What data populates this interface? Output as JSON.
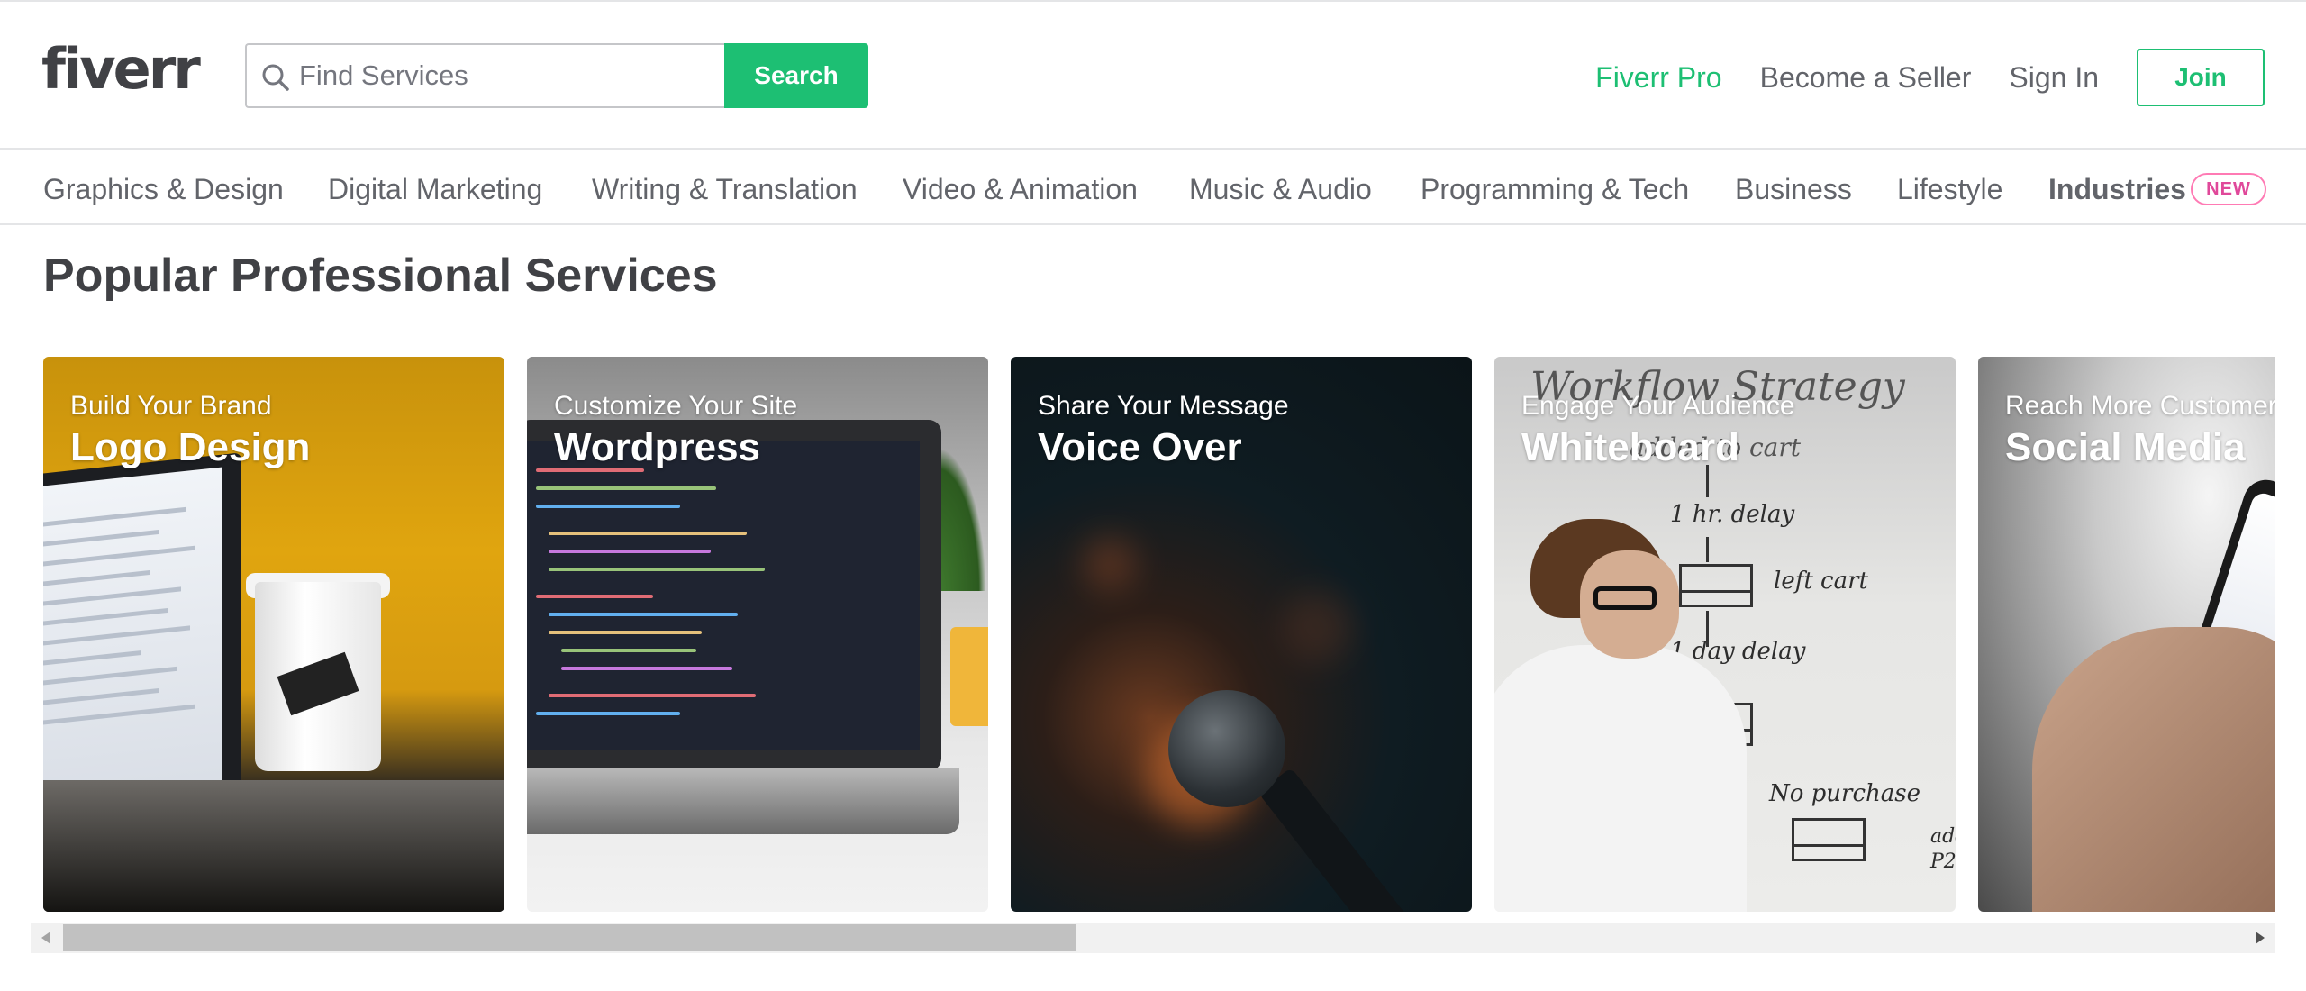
{
  "header": {
    "logo": "fiverr",
    "search": {
      "placeholder": "Find Services",
      "value": "",
      "button_label": "Search",
      "icon": "search-icon"
    },
    "nav": {
      "pro": "Fiverr Pro",
      "seller": "Become a Seller",
      "sign_in": "Sign In",
      "join": "Join"
    }
  },
  "categories": {
    "items": [
      "Graphics & Design",
      "Digital Marketing",
      "Writing & Translation",
      "Video & Animation",
      "Music & Audio",
      "Programming & Tech",
      "Business",
      "Lifestyle",
      "Industries"
    ],
    "badge": "NEW"
  },
  "section": {
    "title": "Popular Professional Services",
    "cards": [
      {
        "subtitle": "Build Your Brand",
        "title": "Logo Design"
      },
      {
        "subtitle": "Customize Your Site",
        "title": "Wordpress"
      },
      {
        "subtitle": "Share Your Message",
        "title": "Voice Over"
      },
      {
        "subtitle": "Engage Your Audience",
        "title": "Whiteboard"
      },
      {
        "subtitle": "Reach More Customers",
        "title": "Social Media"
      }
    ]
  },
  "whiteboard_image": {
    "lines": [
      "Workflow Strategy",
      "added to cart",
      "1 hr. delay",
      "left cart",
      "1 day delay",
      "No purchase",
      "add",
      "P2"
    ]
  },
  "colors": {
    "brand_green": "#1dbf73",
    "text": "#404145",
    "muted": "#62646a",
    "badge_pink": "#e0489a"
  },
  "scrollbar": {
    "position": 0.45
  }
}
